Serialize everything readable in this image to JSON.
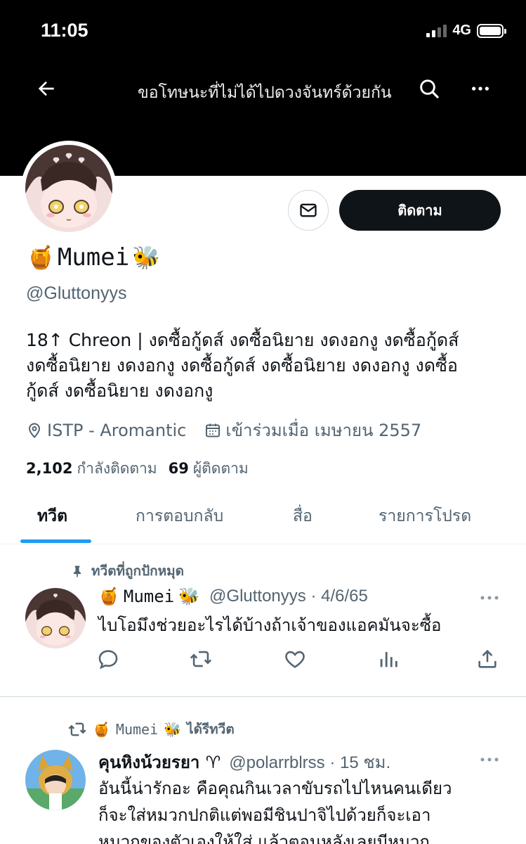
{
  "status_bar": {
    "time": "11:05",
    "network": "4G"
  },
  "nav": {
    "title": "ขอโทษนะที่ไม่ได้ไปดวงจันทร์ด้วยกัน",
    "back_icon": "arrow-left-icon",
    "search_icon": "search-icon",
    "more_icon": "more-horizontal-icon"
  },
  "profile": {
    "name_prefix_emoji": "🍯",
    "name": "Mumei",
    "name_suffix_emoji": "🐝",
    "handle": "@Gluttonyys",
    "follow_label": "ติดตาม",
    "bio_lines": [
      "18↑ Chreon | งดซื้อกู้ดส์ งดซื้อนิยาย งดงอกงู งดซื้อกู้ดส์",
      "งดซื้อนิยาย งดงอกงู งดซื้อกู้ดส์ งดซื้อนิยาย งดงอกงู งดซื้อ",
      "กู้ดส์ งดซื้อนิยาย งดงอกงู"
    ],
    "location": "ISTP - Aromantic",
    "joined": "เข้าร่วมเมื่อ เมษายน 2557",
    "following_count": "2,102",
    "following_label": "กำลังติดตาม",
    "followers_count": "69",
    "followers_label": "ผู้ติดตาม"
  },
  "tabs": [
    {
      "label": "ทวีต",
      "active": true
    },
    {
      "label": "การตอบกลับ",
      "active": false
    },
    {
      "label": "สื่อ",
      "active": false
    },
    {
      "label": "รายการโปรด",
      "active": false
    }
  ],
  "pinned_tweet": {
    "pinned_label": "ทวีตที่ถูกปักหมุด",
    "name": "Mumei",
    "handle_date": "@Gluttonyys · 4/6/65",
    "text": "ไบโอมึงช่วยอะไรได้บ้างถ้าเจ้าของแอคมันจะซื้อ"
  },
  "retweet": {
    "retweeter_name": "Mumei",
    "retweet_label": "ได้รีทวีต",
    "author_name": "คุนหิงน้วยรยา ♈",
    "handle_time": "@polarrblrss · 15 ชม.",
    "text_lines": [
      "อันนี้น่ารักอะ คือคุณกินเวลาขับรถไปไหนคนเดียว",
      "ก็จะใส่หมวกปกติแต่พอมีชินปาจิไปด้วยก็จะเอา",
      "หมวกของตัวเองให้ใส่ แล้วตอนหลังเลยมีหมวก"
    ]
  },
  "colors": {
    "accent": "#1d9bf0",
    "text": "#0f1419",
    "muted": "#536471"
  }
}
